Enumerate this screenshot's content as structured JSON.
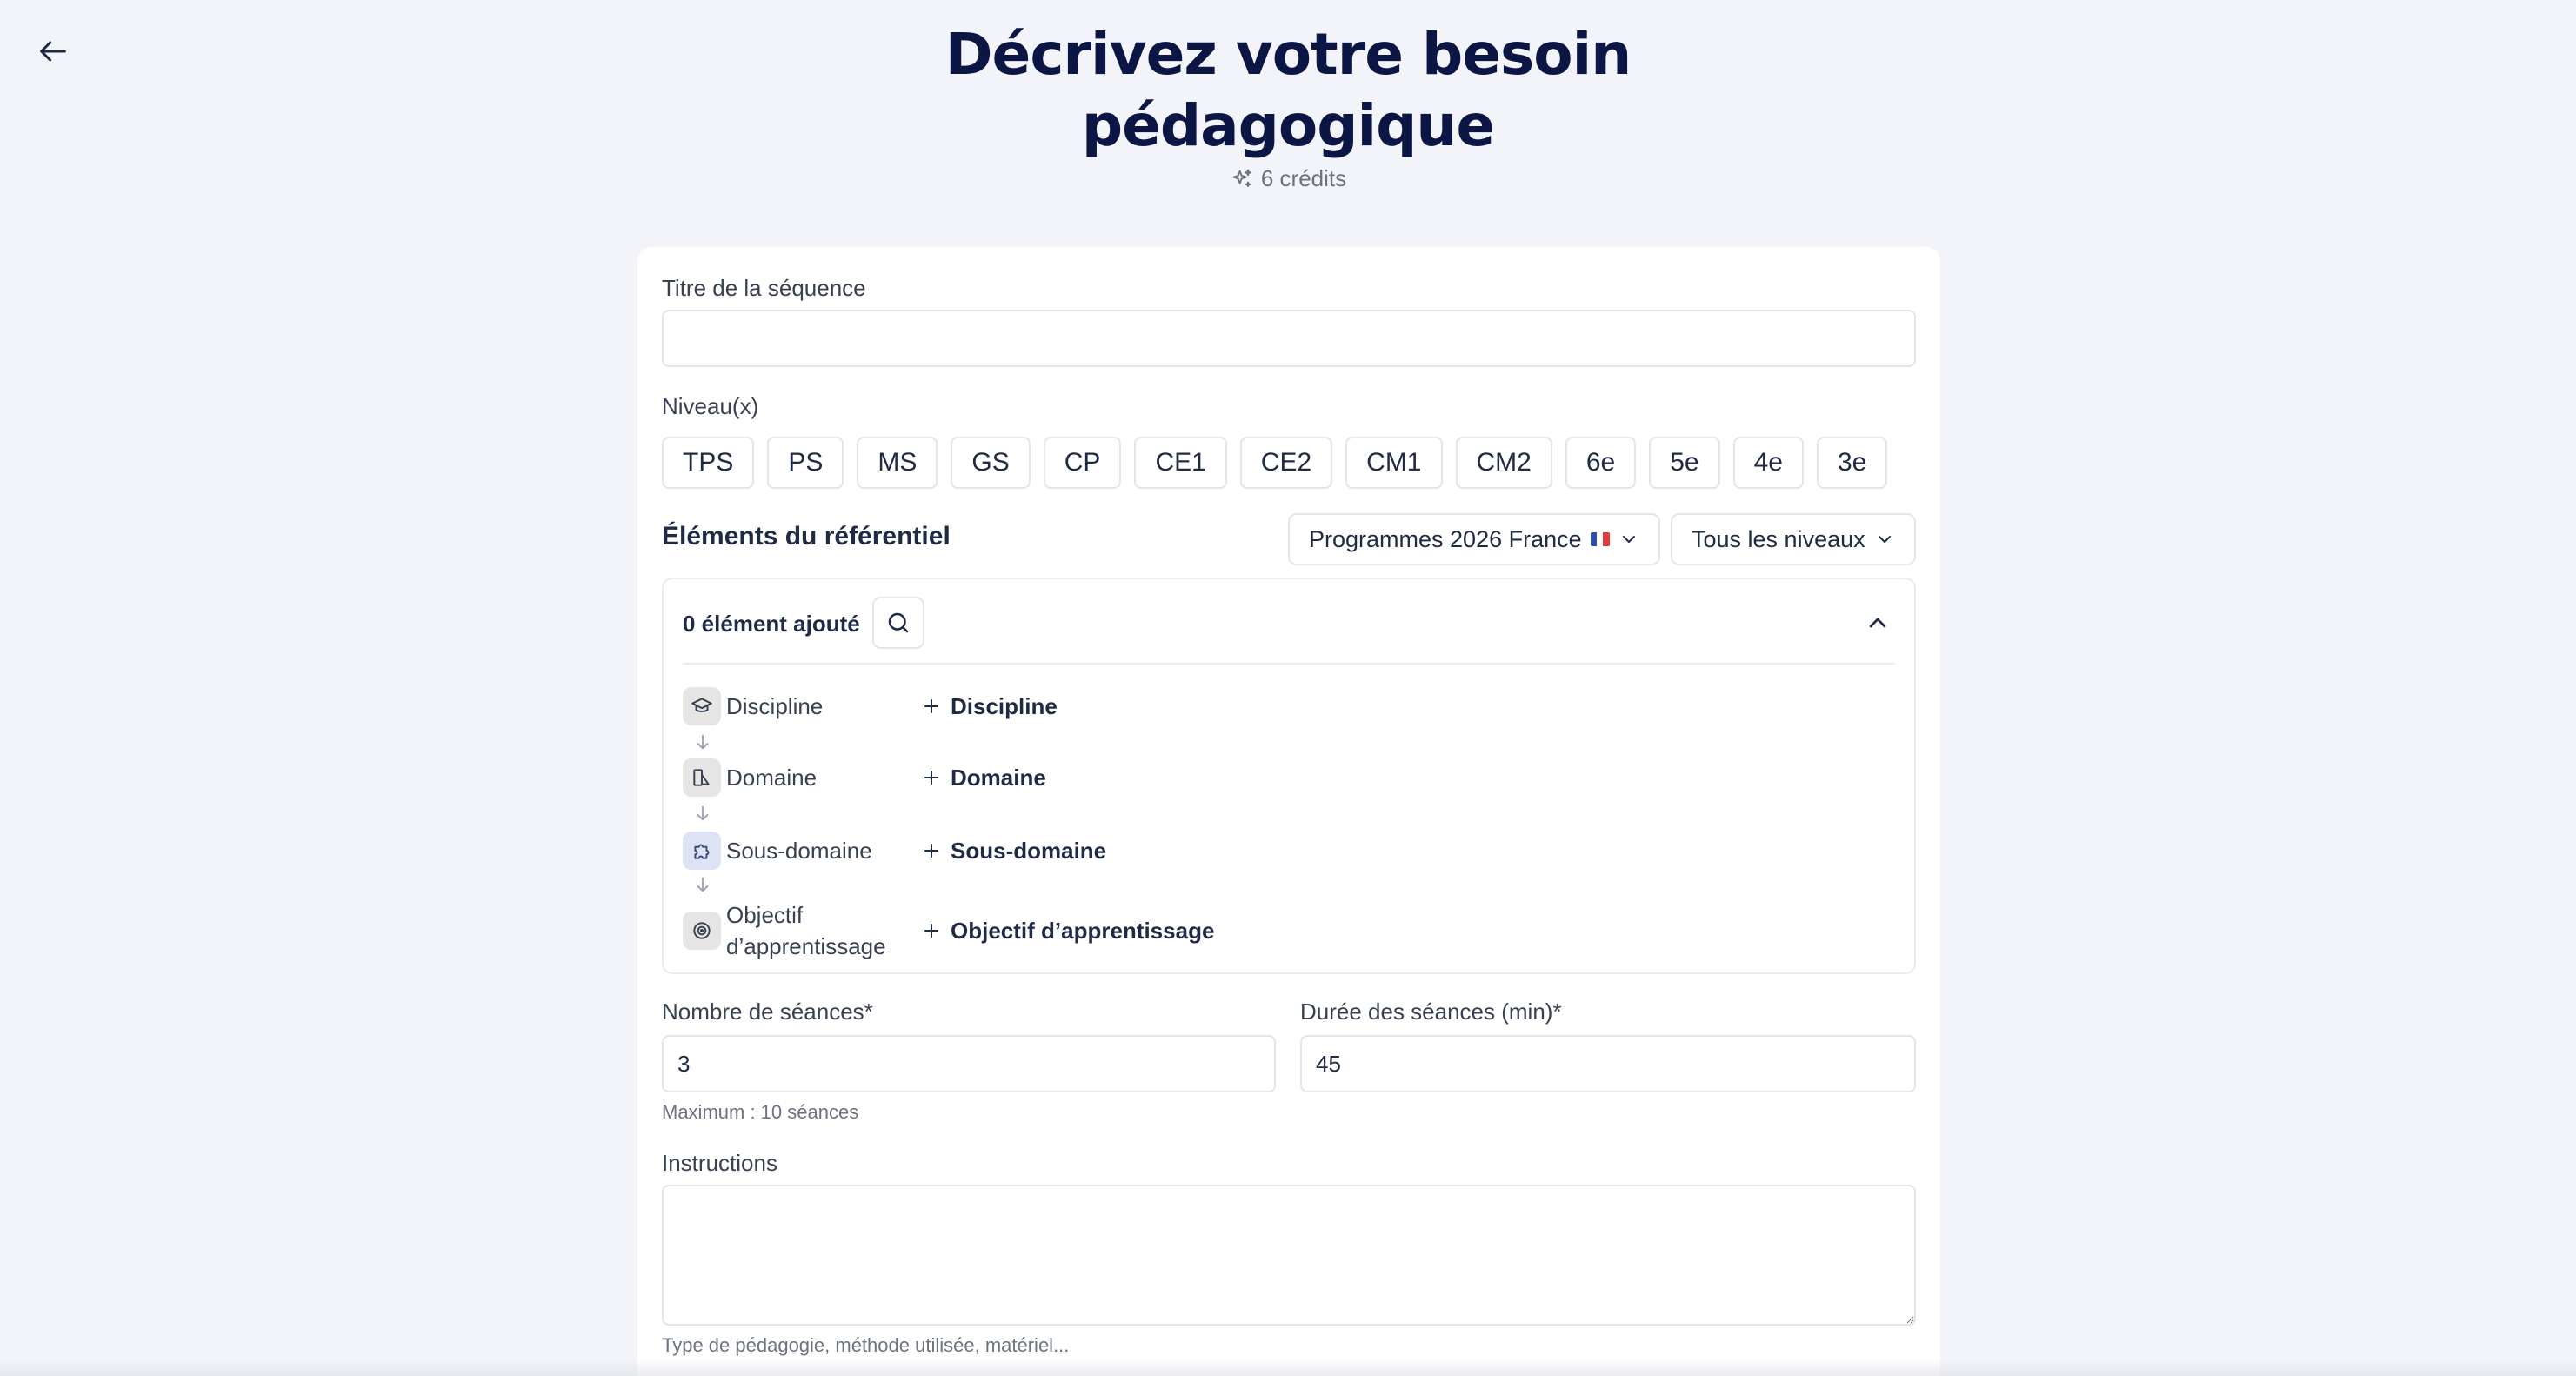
{
  "header": {
    "title_line1": "Décrivez votre besoin",
    "title_line2": "pédagogique",
    "credits": "6 crédits"
  },
  "form": {
    "title_field": {
      "label": "Titre de la séquence",
      "value": "",
      "placeholder": ""
    },
    "levels": {
      "label": "Niveau(x)",
      "options": [
        "TPS",
        "PS",
        "MS",
        "GS",
        "CP",
        "CE1",
        "CE2",
        "CM1",
        "CM2",
        "6e",
        "5e",
        "4e",
        "3e"
      ]
    },
    "referentiel": {
      "title": "Éléments du référentiel",
      "program_dropdown": "Programmes 2026 France",
      "level_dropdown": "Tous les niveaux",
      "count": "0 élément ajouté",
      "rows": [
        {
          "name": "Discipline",
          "add": "Discipline"
        },
        {
          "name": "Domaine",
          "add": "Domaine"
        },
        {
          "name": "Sous-domaine",
          "add": "Sous-domaine"
        },
        {
          "name_line1": "Objectif",
          "name_line2": "d’apprentissage",
          "add": "Objectif d’apprentissage"
        }
      ]
    },
    "sessions": {
      "label": "Nombre de séances*",
      "value": "3",
      "hint": "Maximum : 10 séances"
    },
    "duration": {
      "label": "Durée des séances (min)*",
      "value": "45"
    },
    "instructions": {
      "label": "Instructions",
      "value": "",
      "hint": "Type de pédagogie, méthode utilisée, matériel..."
    }
  },
  "colors": {
    "title": "#0c1645",
    "background": "#f3f4f9",
    "card": "#ffffff",
    "border": "#e3e5ec"
  },
  "icons": {
    "back": "arrow-left-icon",
    "credits": "sparkles-icon",
    "search": "search-icon",
    "collapse": "chevron-up-icon",
    "discipline": "graduation-cap-icon",
    "domaine": "book-layout-icon",
    "sous_domaine": "puzzle-icon",
    "objectif": "target-icon"
  }
}
